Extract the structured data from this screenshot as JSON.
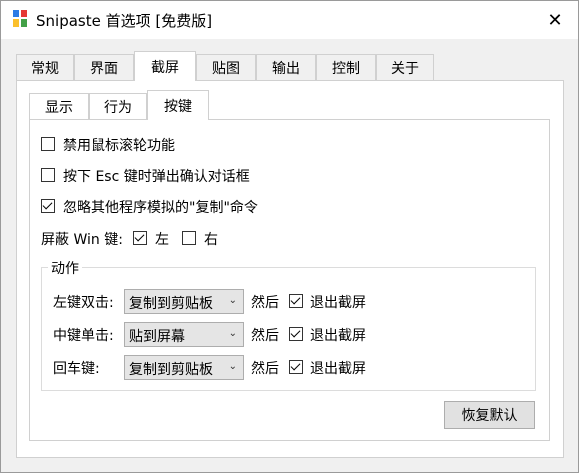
{
  "window": {
    "title": "Snipaste 首选项 [免费版]",
    "close": "✕"
  },
  "tabs": [
    "常规",
    "界面",
    "截屏",
    "贴图",
    "输出",
    "控制",
    "关于"
  ],
  "subtabs": [
    "显示",
    "行为",
    "按键"
  ],
  "options": {
    "disable_wheel": {
      "label": "禁用鼠标滚轮功能",
      "checked": false
    },
    "esc_confirm": {
      "label": "按下 Esc 键时弹出确认对话框",
      "checked": false
    },
    "ignore_copy": {
      "label": "忽略其他程序模拟的\"复制\"命令",
      "checked": true
    }
  },
  "shield_win": {
    "label": "屏蔽 Win 键:",
    "left": {
      "label": "左",
      "checked": true
    },
    "right": {
      "label": "右",
      "checked": false
    }
  },
  "actions": {
    "title": "动作",
    "rows": [
      {
        "label": "左键双击:",
        "value": "复制到剪贴板",
        "then": "然后",
        "exit_label": "退出截屏",
        "exit_checked": true
      },
      {
        "label": "中键单击:",
        "value": "贴到屏幕",
        "then": "然后",
        "exit_label": "退出截屏",
        "exit_checked": true
      },
      {
        "label": "回车键:",
        "value": "复制到剪贴板",
        "then": "然后",
        "exit_label": "退出截屏",
        "exit_checked": true
      }
    ]
  },
  "restore_default": "恢复默认"
}
